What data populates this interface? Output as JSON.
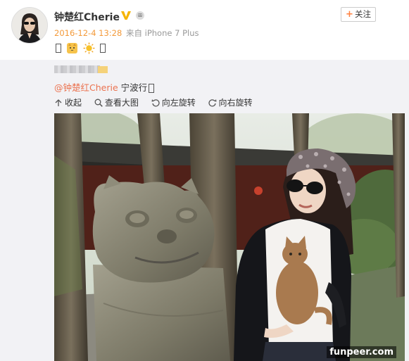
{
  "user": {
    "name": "钟楚红Cherie",
    "timestamp": "2016-12-4 13:28",
    "source_prefix": "来自",
    "device": "iPhone 7 Plus"
  },
  "follow_button": {
    "plus": "+",
    "label": "关注"
  },
  "post": {
    "text_emojis": [
      "cat-emoji",
      "sun-emoji"
    ]
  },
  "repost": {
    "mention": "@钟楚红Cherie",
    "location": "宁波行"
  },
  "tools": [
    {
      "icon": "collapse-icon",
      "label": "收起"
    },
    {
      "icon": "zoom-icon",
      "label": "查看大图"
    },
    {
      "icon": "rotate-left-icon",
      "label": "向左旋转"
    },
    {
      "icon": "rotate-right-icon",
      "label": "向右旋转"
    }
  ],
  "photo": {
    "watermark": "funpeer.com"
  },
  "colors": {
    "accent": "#f39a3a",
    "mention": "#eb7350",
    "repost_bg": "#f2f2f5",
    "verified": "#f5b400"
  }
}
